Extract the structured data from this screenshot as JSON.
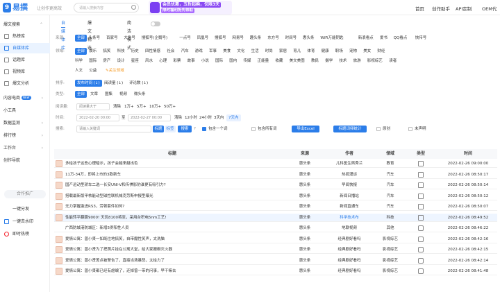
{
  "header": {
    "logo_icon": "9",
    "logo_text": "易撰",
    "slogan": "让创作更高效",
    "search_placeholder": "请输入搜索内容",
    "banner_line1": "会员优惠，五折起购，仅限3天",
    "banner_line2": "限时福利抢先领取",
    "nav": [
      "首页",
      "创作助手",
      "API定制",
      "OEM代"
    ]
  },
  "sidebar": {
    "section1": "爆文搜索",
    "section1_items": [
      "热榜库",
      "自媒体库",
      "话题库",
      "视频库",
      "爆文分析"
    ],
    "section2": "内容电商",
    "section2_badge": "NEW",
    "section3": "小工具",
    "section4": "数据监测",
    "section5": "排行榜",
    "section6": "工作台",
    "section7": "创作导航",
    "coop_button": "合作推广",
    "extra_items": [
      "一键分发",
      "一键去水印",
      "即时热榜"
    ]
  },
  "main": {
    "tabs": [
      "自媒体库",
      "爆文精选"
    ],
    "toggle_label": "简洁模式",
    "source": {
      "label": "来源:",
      "items": [
        "全部",
        "头条号",
        "百家号",
        "大鱼号",
        "搜狐号(企鹅号)",
        "一点号",
        "凤凰号",
        "搜狐号",
        "网易号",
        "趣头条",
        "东方号",
        "时间号",
        "惠头条",
        "WiFi万能钥匙",
        "新浪看点",
        "爱书",
        "QQ看点",
        "快传号"
      ]
    },
    "field": {
      "label": "领域:",
      "row1": [
        "全部",
        "娱乐",
        "搞笑",
        "科技",
        "历史",
        "四性情感",
        "社会",
        "汽车",
        "游戏",
        "军事",
        "美食",
        "文化",
        "生活",
        "时尚",
        "家居",
        "育儿",
        "体育",
        "健康",
        "职场",
        "宠物",
        "美女",
        "财经"
      ],
      "row2": [
        "科学",
        "国际",
        "房产",
        "设计",
        "星座",
        "风水",
        "心理",
        "彩票",
        "故事",
        "小说",
        "国际",
        "国内",
        "传媒",
        "正能量",
        "收藏",
        "美文美图",
        "教民",
        "摄学",
        "技术",
        "旅游",
        "影视综艺",
        "读者"
      ],
      "row3": [
        "人文",
        "公益"
      ],
      "follow_label": "关注领域"
    },
    "sort": {
      "label": "排序:",
      "items": [
        "发布时间 (↓)",
        "阅读量 (↓)",
        "评论数 (↓)"
      ]
    },
    "type": {
      "label": "类型:",
      "items": [
        "全部",
        "文章",
        "图集",
        "视频",
        "微头条"
      ]
    },
    "reads": {
      "label": "阅读量:",
      "placeholder": "阅读量大于",
      "clear": "清除",
      "items": [
        "1万+",
        "5万+",
        "10万+",
        "50万+"
      ]
    },
    "time": {
      "label": "时间:",
      "start": "2022-02-20 00:00",
      "separator": "至",
      "end": "2022-02-27 00:00",
      "clear": "清除",
      "items": [
        "12小时",
        "24小时",
        "3天内",
        "7天内"
      ]
    },
    "search": {
      "label": "搜索:",
      "placeholder": "请输入关键词",
      "mode_title": "标题",
      "mode_text": "标签",
      "search_btn": "搜索",
      "contains_one": "包含一个词",
      "contains_all": "包含所有词",
      "export_btn": "导出Excel",
      "stats_btn": "标题词频统计",
      "original": "原创",
      "unpublished": "未声明"
    }
  },
  "table": {
    "headers": [
      "标题",
      "来源",
      "作者",
      "领域",
      "类型",
      "时间"
    ],
    "rows": [
      {
        "title": "多给孩子这些心理暗示，孩子会越来越出色",
        "source": "惠头条",
        "author": "儿科医生熊秀兰",
        "field": "教育",
        "type": "doc",
        "time": "2022-02-26 09:00:00"
      },
      {
        "title": "11万-34万，即将上市的3款新车",
        "source": "惠头条",
        "author": "热闻漫谈",
        "field": "汽车",
        "type": "doc",
        "time": "2022-02-26 08:50:17"
      },
      {
        "title": "国产运动型轿车二选一长安UNI-V和传祺影豹谁更有吸引力?",
        "source": "惠头条",
        "author": "早闻快报",
        "field": "汽车",
        "type": "doc",
        "time": "2022-02-26 08:50:14"
      },
      {
        "title": "搭载最新版甲核能动型磁性联机械克劳斯申报型曝光",
        "source": "惠头条",
        "author": "新闻日播站",
        "field": "汽车",
        "type": "doc",
        "time": "2022-02-26 08:50:12"
      },
      {
        "title": "无力掌握激进RS3，劳顿套件如何?",
        "source": "惠头条",
        "author": "新闻直通车",
        "field": "汽车",
        "type": "doc",
        "time": "2022-02-26 08:50:07"
      },
      {
        "title": "性能转平翻骤9000! 天玑8100将至，采用台积电5nm工艺!",
        "source": "惠头条",
        "author": "科学技术布",
        "field": "科技",
        "type": "doc",
        "time": "2022-02-26 08:49:52",
        "highlight": true
      },
      {
        "title": "广西防城港防城区：新增5例阳性人员",
        "source": "惠头条",
        "author": "地联视频",
        "field": "其他",
        "type": "video",
        "time": "2022-02-26 08:46:22",
        "nothumb": true
      },
      {
        "title": "爱情公寓：曾小贤一如既往地搞笑，自带魔性笑声，太洗脑",
        "source": "惠头条",
        "author": "经典剧好看吗",
        "field": "影视综艺",
        "type": "video",
        "time": "2022-02-26 08:42:16"
      },
      {
        "title": "爱情公寓：曾小贤为了把照片挂在公寓大堂，给大家搬橱灭火器",
        "source": "惠头条",
        "author": "经典剧好看吗",
        "field": "影视综艺",
        "type": "video",
        "time": "2022-02-26 08:42:15"
      },
      {
        "title": "爱情公寓：曾小贤差点被警告了，直接当场暴怒，太给力了",
        "source": "惠头条",
        "author": "经典剧好看吗",
        "field": "影视综艺",
        "type": "video",
        "time": "2022-02-26 08:42:14"
      },
      {
        "title": "爱情公寓：曾小贤都已经有虐编了，还掉曾一带的问事，早干嘛去",
        "source": "惠头条",
        "author": "经典剧好看吗",
        "field": "影视综艺",
        "type": "video",
        "time": "2022-02-26 08:41:48"
      }
    ]
  },
  "colors": {
    "accent": "#2b7de9",
    "highlight_author": "#2b7de9",
    "banner": "#8a4af3"
  }
}
